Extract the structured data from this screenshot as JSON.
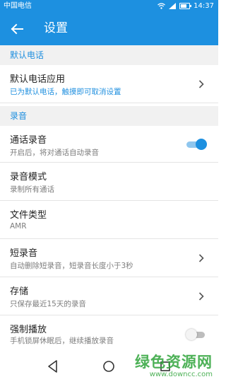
{
  "status_bar": {
    "carrier": "中国电信",
    "time": "14:37"
  },
  "app_bar": {
    "title": "设置",
    "back_icon": "arrow-left-icon"
  },
  "sections": {
    "default_phone": {
      "header": "默认电话",
      "default_app": {
        "title": "默认电话应用",
        "subtitle": "已为默认电话，触摸即可取消设置"
      }
    },
    "recording": {
      "header": "录音",
      "call_recording": {
        "title": "通话录音",
        "subtitle": "开启后，将对通话自动录音",
        "enabled": true
      },
      "record_mode": {
        "title": "录音模式",
        "subtitle": "录制所有通话"
      },
      "file_type": {
        "title": "文件类型",
        "subtitle": "AMR"
      },
      "short_recording": {
        "title": "短录音",
        "subtitle": "自动删除短录音，短录音长度小于3秒"
      },
      "storage": {
        "title": "存储",
        "subtitle": "只保存最近15天的录音"
      },
      "force_playback": {
        "title": "强制播放",
        "subtitle": "手机锁屏休眠后，继续播放录音",
        "enabled": false
      }
    }
  },
  "watermark": {
    "main": "绿色资源网",
    "sub": "www.downcc.com"
  },
  "colors": {
    "accent": "#1d90e0",
    "section_bg": "#f1f1f1",
    "text_primary": "#222222",
    "text_secondary": "#7d7d7d"
  }
}
